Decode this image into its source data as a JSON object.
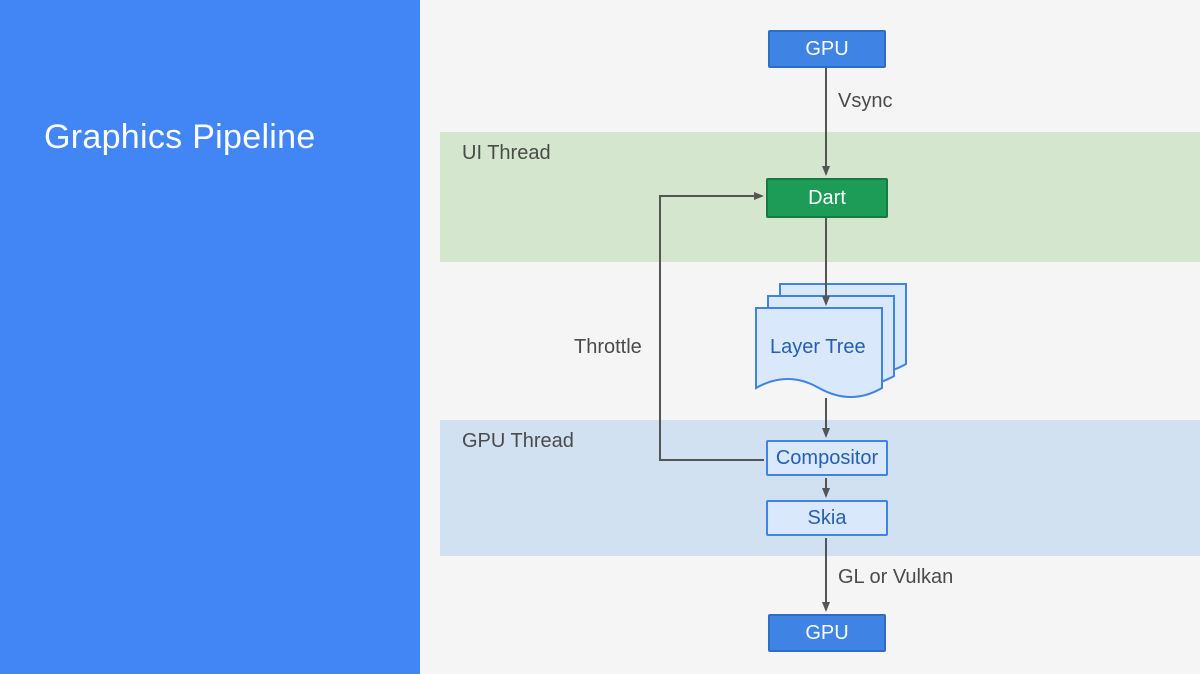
{
  "slide": {
    "title": "Graphics Pipeline"
  },
  "bands": {
    "ui": "UI Thread",
    "gpu": "GPU Thread"
  },
  "nodes": {
    "gpu_top": "GPU",
    "dart": "Dart",
    "layer_tree": "Layer Tree",
    "compositor": "Compositor",
    "skia": "Skia",
    "gpu_bottom": "GPU"
  },
  "edges": {
    "vsync": "Vsync",
    "throttle": "Throttle",
    "gl_or_vulkan": "GL or Vulkan"
  },
  "colors": {
    "blue": "#4285f4",
    "green_node": "#1c9c56",
    "band_green": "#d4e7ce",
    "band_blue": "#d1e1f1",
    "light_blue": "#d9e8fa"
  }
}
